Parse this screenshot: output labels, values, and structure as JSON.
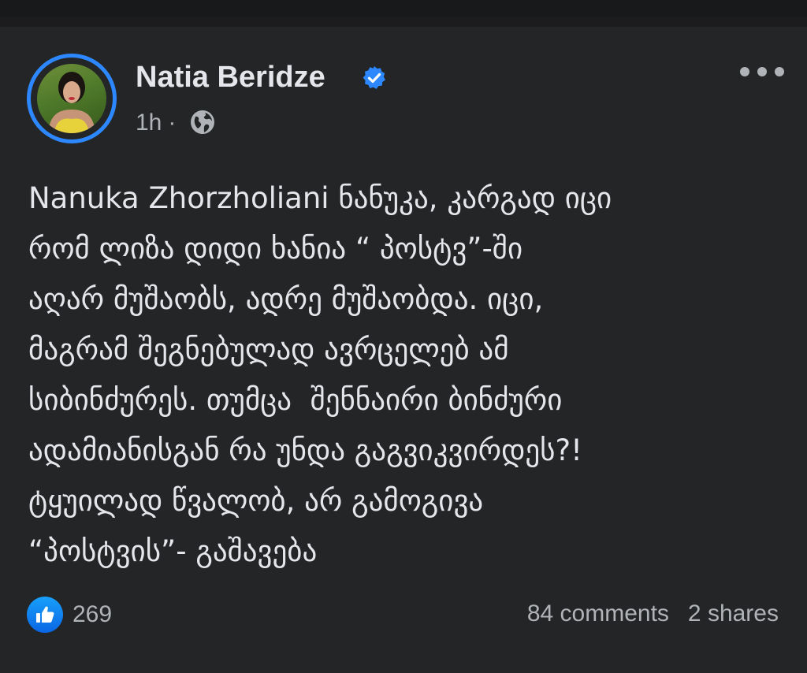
{
  "post": {
    "author": "Natia Beridze",
    "verified": true,
    "time": "1h",
    "separator": "·",
    "privacy_icon": "globe-icon",
    "more_icon": "more-options-icon",
    "text": "Nanuka Zhorzholiani ნანუკა, კარგად იცი\nრომ ლიზა დიდი ხანია “ პოსტვ”-ში\nაღარ მუშაობს, ადრე მუშაობდა. იცი,\nმაგრამ შეგნებულად ავრცელებ ამ\nსიბინძურეს. თუმცა  შენნაირი ბინძური\nადამიანისგან რა უნდა გაგვიკვირდეს?!\nტყუილად წვალობ, არ გამოგივა\n“პოსტვის”- გაშავება"
  },
  "reactions": {
    "icon": "like-icon",
    "count": "269"
  },
  "stats": {
    "comments": "84 comments",
    "shares": "2 shares"
  },
  "colors": {
    "background": "#242526",
    "text": "#e4e6eb",
    "secondary_text": "#b0b3b8",
    "accent": "#2d88ff"
  }
}
